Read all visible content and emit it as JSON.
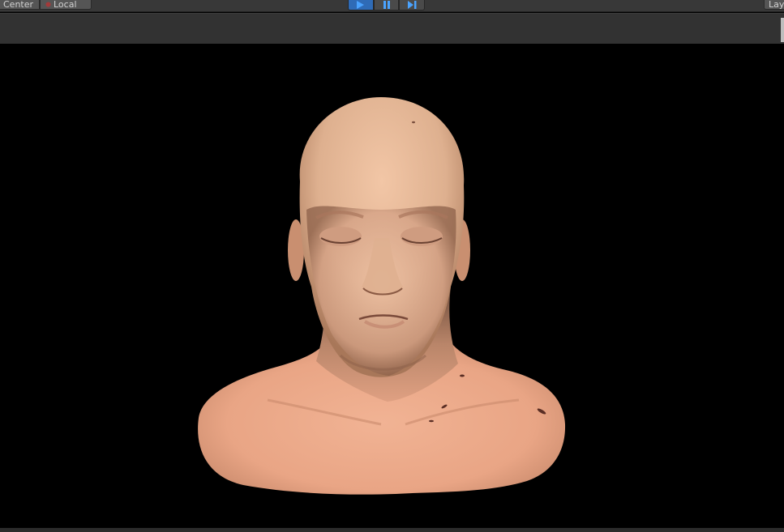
{
  "toolbar": {
    "pivot_center_label": "Center",
    "pivot_local_label": "Local",
    "layers_label": "Lay",
    "play_icon": "play-icon",
    "pause_icon": "pause-icon",
    "step_icon": "step-icon",
    "accent_color": "#2f6bb6"
  },
  "viewport": {
    "subject": "3d-head-bust-model",
    "background_color": "#000000",
    "skin_color": "#e8a585"
  }
}
